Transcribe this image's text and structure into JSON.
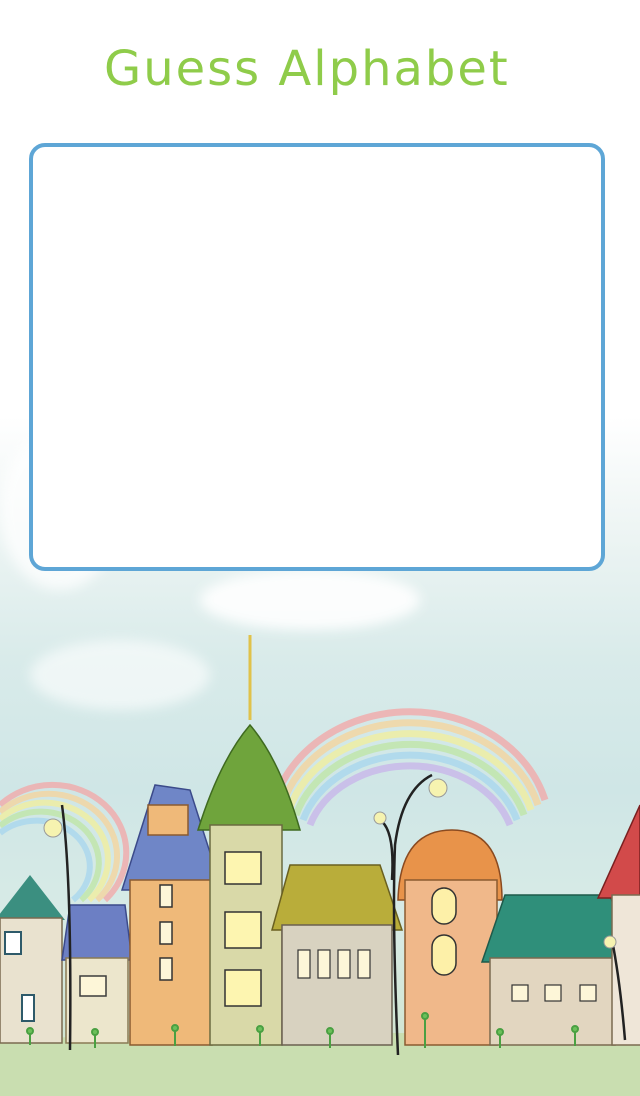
{
  "app": {
    "title": "Guess Alphabet"
  },
  "colors": {
    "title_text": "#8fcc4a",
    "card_border": "#5ea6d6",
    "card_background": "#ffffff"
  },
  "answer_card": {
    "content": ""
  },
  "background": {
    "icon": "town-rainbow-illustration"
  }
}
